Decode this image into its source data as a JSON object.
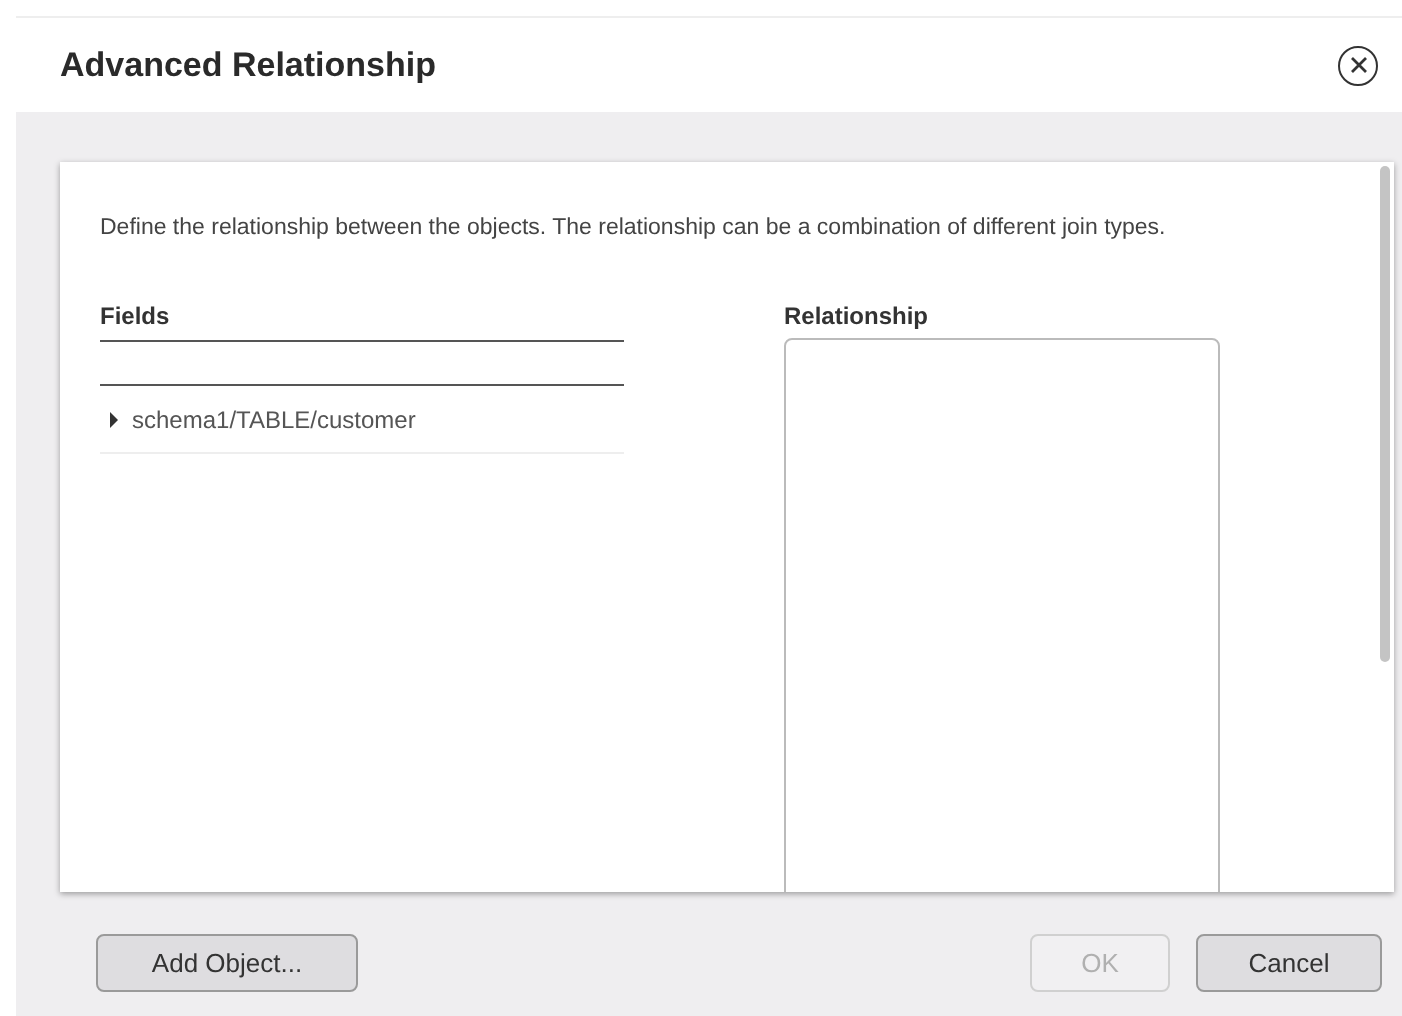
{
  "dialog": {
    "title": "Advanced Relationship"
  },
  "description": "Define the relationship between the objects. The relationship can be a combination of different join types.",
  "fields": {
    "heading": "Fields",
    "items": [
      {
        "label": "schema1/TABLE/customer",
        "expanded": false
      }
    ]
  },
  "relationship": {
    "heading": "Relationship"
  },
  "buttons": [
    {
      "label": "Add Object...",
      "disabled": false
    },
    {
      "label": "OK",
      "disabled": true
    },
    {
      "label": "Cancel",
      "disabled": false
    }
  ]
}
